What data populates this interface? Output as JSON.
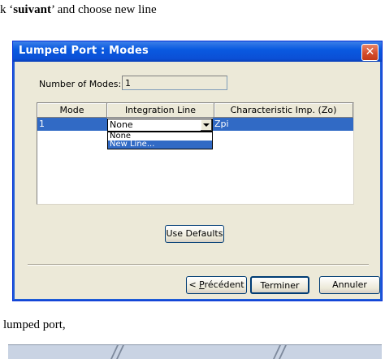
{
  "document": {
    "top_prefix": "k ‘",
    "top_bold": "suivant",
    "top_suffix": "’ and choose new line",
    "bottom_text": "lumped port,"
  },
  "dialog": {
    "title": "Lumped Port : Modes",
    "close_glyph": "✕",
    "number_of_modes_label": "Number of Modes:",
    "number_of_modes_value": "1",
    "table": {
      "headers": [
        "Mode",
        "Integration Line",
        "Characteristic Imp. (Zo)"
      ],
      "rows": [
        {
          "mode": "1",
          "integration_line": "None",
          "characteristic_imp": "Zpi"
        }
      ]
    },
    "dropdown_options": [
      "None",
      "New Line..."
    ],
    "dropdown_selected_index": 1,
    "buttons": {
      "use_defaults": "Use Defaults",
      "back_prefix": "< ",
      "back_mnemonic": "P",
      "back_rest": "récédent",
      "finish": "Terminer",
      "cancel": "Annuler"
    }
  },
  "colors": {
    "title_bar": "#0a5ae0",
    "selection": "#316ac5",
    "dialog_face": "#ece9d8",
    "close_button": "#d54d2c"
  },
  "icons": {
    "close": "close-icon",
    "dropdown_arrow": "chevron-down-icon"
  }
}
